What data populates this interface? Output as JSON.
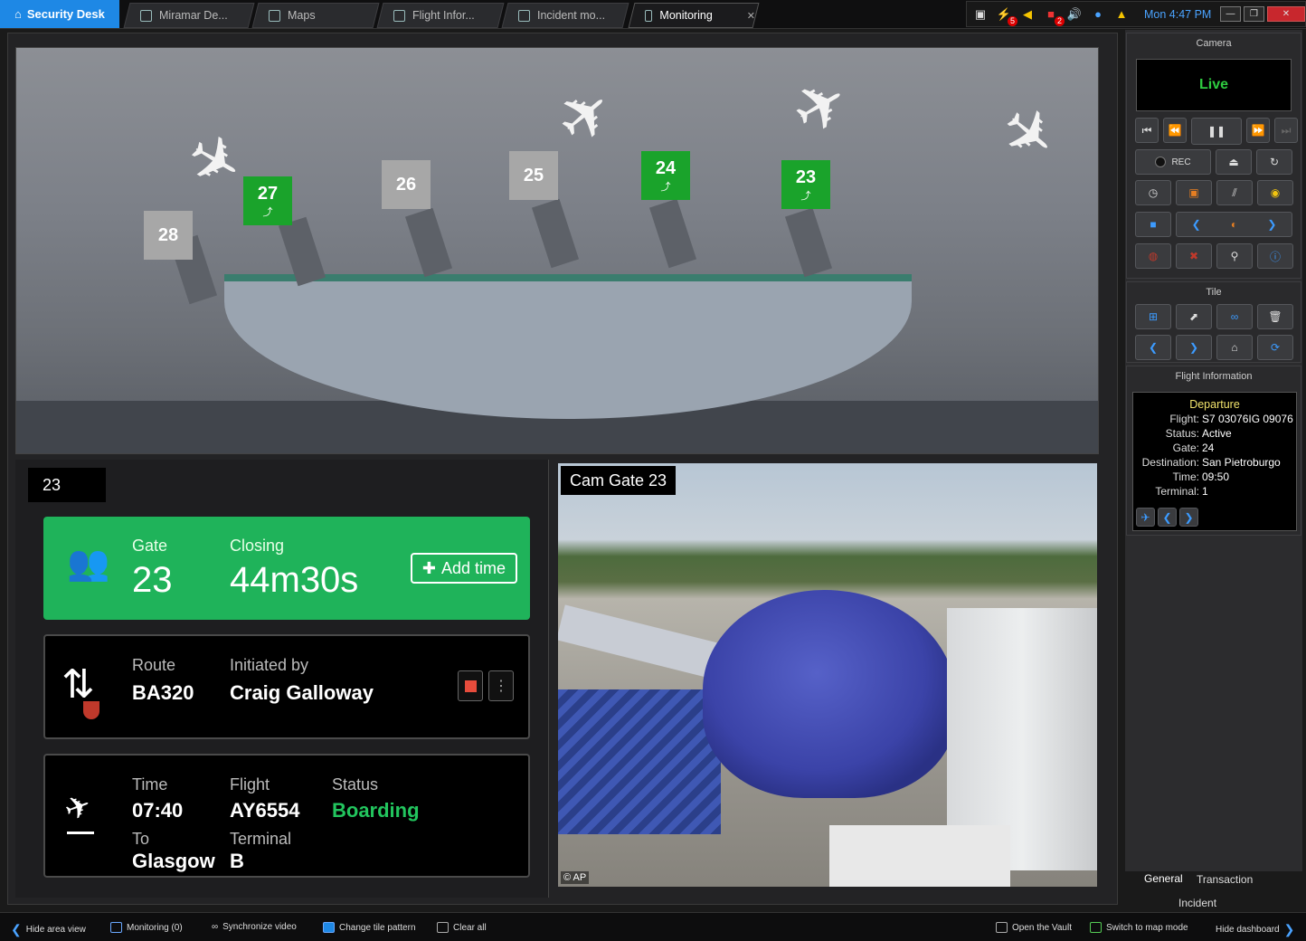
{
  "tabs": {
    "home": "Security Desk",
    "items": [
      {
        "label": "Miramar De..."
      },
      {
        "label": "Maps"
      },
      {
        "label": "Flight Infor..."
      },
      {
        "label": "Incident mo..."
      },
      {
        "label": "Monitoring"
      }
    ],
    "close_glyph": "✕"
  },
  "tray": {
    "badge_alarms": "5",
    "badge_alerts": "2",
    "clock": "Mon 4:47 PM"
  },
  "map": {
    "gates": [
      {
        "num": "28",
        "state": "inactive"
      },
      {
        "num": "27",
        "state": "active"
      },
      {
        "num": "26",
        "state": "inactive"
      },
      {
        "num": "25",
        "state": "inactive"
      },
      {
        "num": "24",
        "state": "active"
      },
      {
        "num": "23",
        "state": "active"
      }
    ],
    "colors": {
      "active": "#1aa32b",
      "inactive": "#a7a7a7"
    }
  },
  "gate_info": {
    "tag": "23",
    "gate_label": "Gate",
    "gate_value": "23",
    "closing_label": "Closing",
    "closing_value": "44m30s",
    "add_time": "Add time",
    "route_label": "Route",
    "route_value": "BA320",
    "initiated_label": "Initiated by",
    "initiated_value": "Craig Galloway",
    "time_label": "Time",
    "time_value": "07:40",
    "flight_label": "Flight",
    "flight_value": "AY6554",
    "status_label": "Status",
    "status_value": "Boarding",
    "to_label": "To",
    "to_value": "Glasgow",
    "terminal_label": "Terminal",
    "terminal_value": "B"
  },
  "camera_tile": {
    "label": "Cam Gate 23",
    "credit": "© AP"
  },
  "panel": {
    "camera_title": "Camera",
    "live": "Live",
    "rec": "REC",
    "tile_title": "Tile",
    "flight_title": "Flight Information",
    "flight": {
      "heading": "Departure",
      "rows": [
        {
          "k": "Flight:",
          "v": "S7 03076IG 09076"
        },
        {
          "k": "Status:",
          "v": "Active"
        },
        {
          "k": "Gate:",
          "v": "24"
        },
        {
          "k": "Destination:",
          "v": "San Pietroburgo"
        },
        {
          "k": "Time:",
          "v": "09:50"
        },
        {
          "k": "Terminal:",
          "v": "1"
        }
      ]
    },
    "tab_general": "General",
    "tab_transaction": "Transaction",
    "tab_incident": "Incident"
  },
  "bottom": {
    "hide_area": "Hide area view",
    "monitoring": "Monitoring (0)",
    "sync": "Synchronize video",
    "tile_pattern": "Change tile pattern",
    "clear": "Clear all",
    "vault": "Open the Vault",
    "map_mode": "Switch to map mode",
    "hide_dash": "Hide dashboard"
  }
}
